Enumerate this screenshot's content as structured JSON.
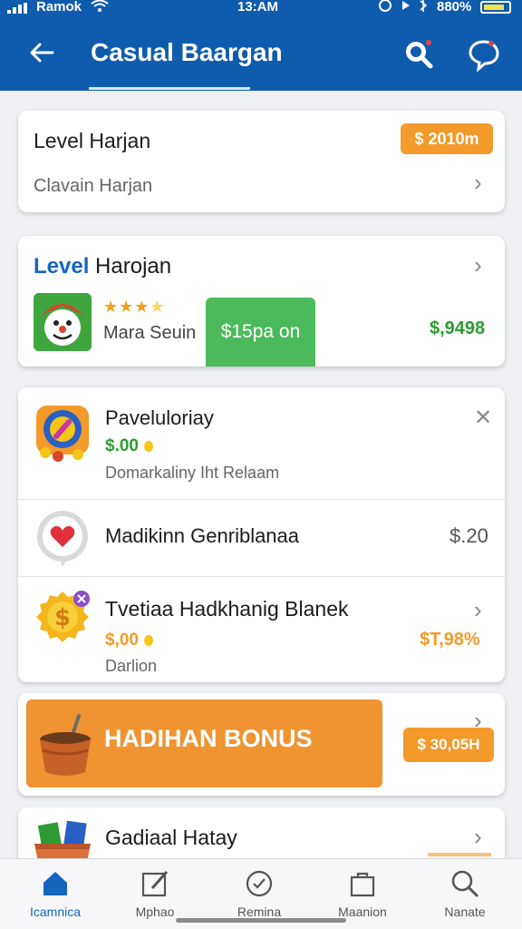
{
  "status_bar": {
    "carrier": "Ramok",
    "time": "13:AM",
    "battery": "880%"
  },
  "header": {
    "title": "Casual Baargan",
    "back_icon": "arrow-left-icon",
    "search_icon": "search-icon",
    "chat_icon": "chat-bubble-icon"
  },
  "card1": {
    "title": "Level Harjan",
    "subtitle": "Clavain Harjan",
    "price": "$ 2010m"
  },
  "card2": {
    "title_highlight": "Level",
    "title_rest": "Harojan",
    "rating_stars": 3,
    "user_name": "Mara Seuin",
    "action_button": "$15pa on",
    "amount": "$,9498"
  },
  "list": [
    {
      "title": "Paveluloriay",
      "price": "$.00",
      "subtitle": "Domarkaliny Iht Relaam"
    },
    {
      "title": "Madikinn Genriblanaa",
      "amount": "$.20"
    },
    {
      "title": "Tvetiaa Hadkhanig Blanek",
      "price": "$,00",
      "subtitle": "Darlion",
      "amount": "$T,98%"
    }
  ],
  "bonus": {
    "label": "HADIHAN BONUS",
    "price": "$ 30,05H"
  },
  "card5": {
    "title": "Gadiaal Hatay"
  },
  "bottom_nav": [
    {
      "label": "Icamnica",
      "icon": "home-icon",
      "active": true
    },
    {
      "label": "Mphao",
      "icon": "edit-icon",
      "active": false
    },
    {
      "label": "Remina",
      "icon": "badge-icon",
      "active": false
    },
    {
      "label": "Maanion",
      "icon": "bag-icon",
      "active": false
    },
    {
      "label": "Nanate",
      "icon": "search-icon",
      "active": false
    }
  ],
  "colors": {
    "header_blue": "#0f5cae",
    "accent_orange": "#f39a2a",
    "accent_green": "#2e9b32",
    "button_green": "#4cba5a",
    "link_blue": "#1565c0"
  }
}
